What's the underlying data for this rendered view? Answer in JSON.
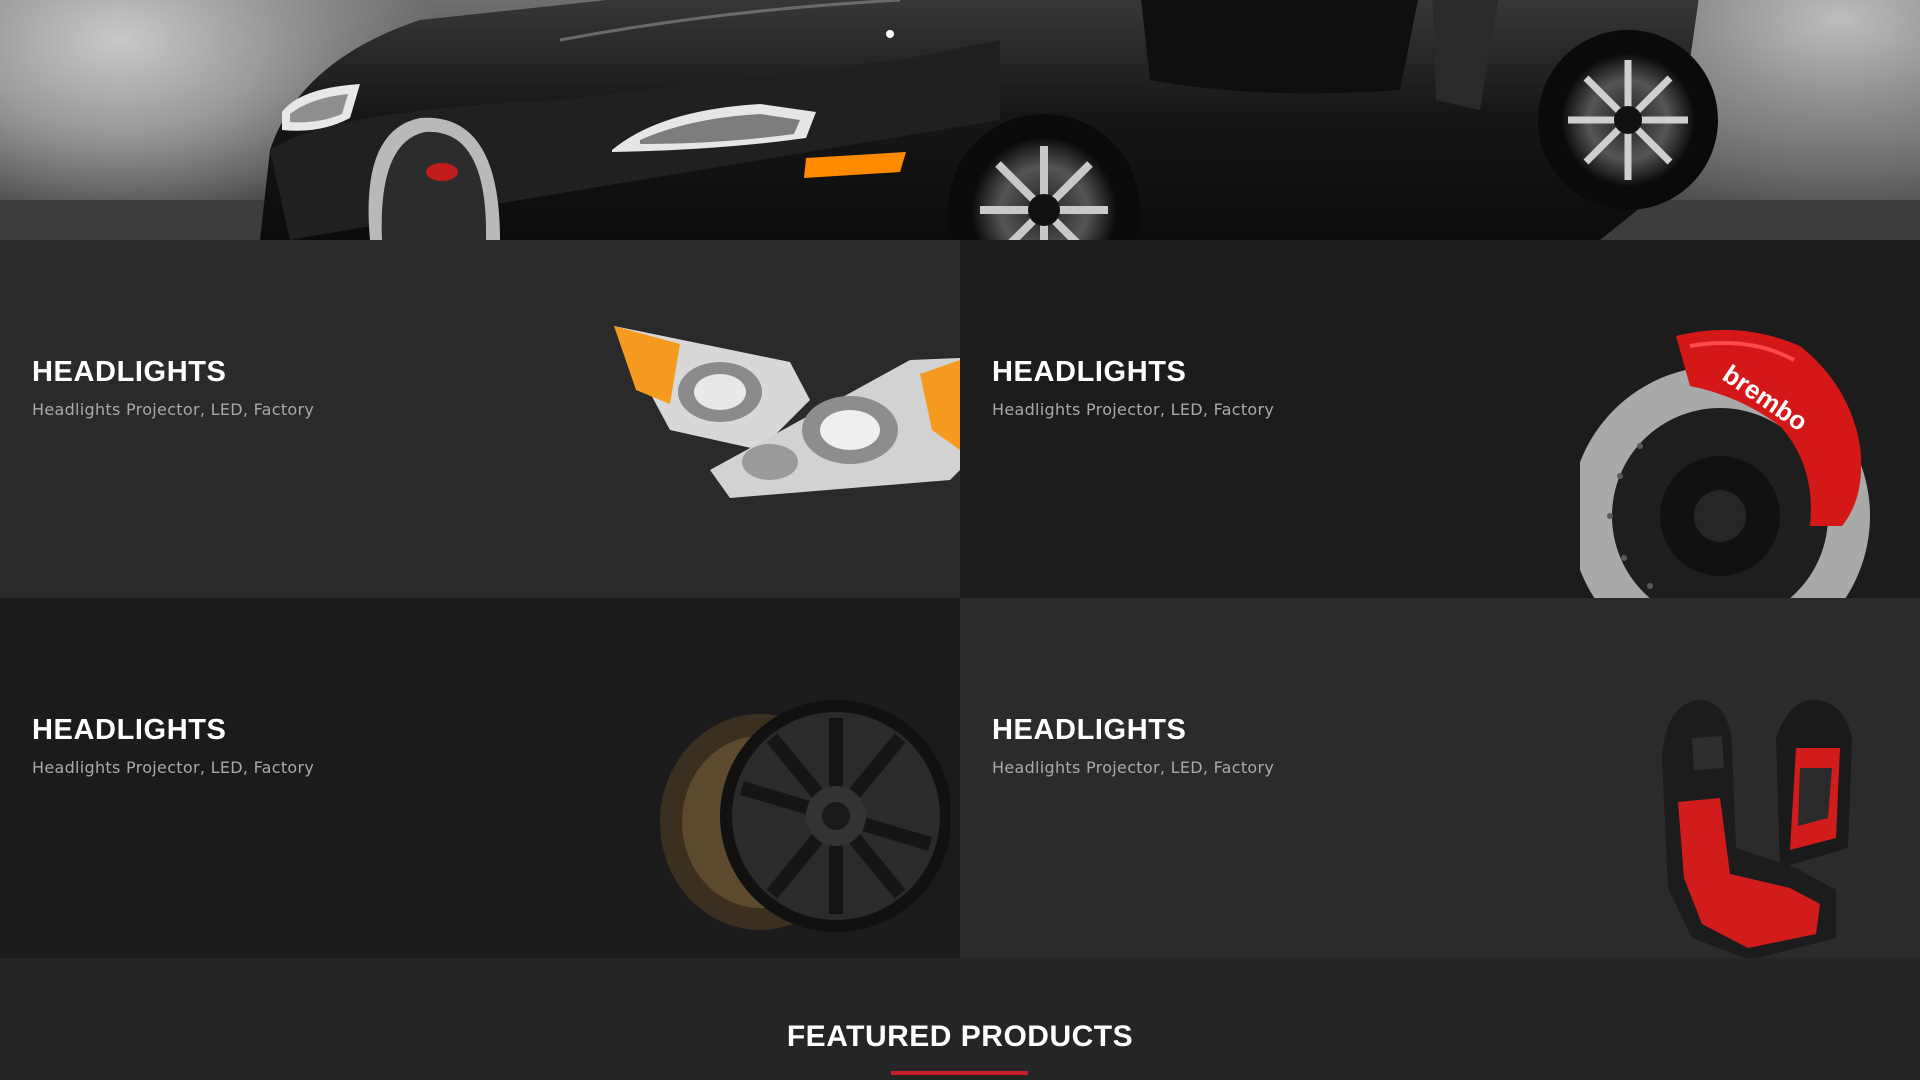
{
  "hero": {
    "alt": "black-sports-car"
  },
  "categories": [
    {
      "title": "HEADLIGHTS",
      "subtitle": "Headlights Projector, LED, Factory",
      "icon": "headlights-image"
    },
    {
      "title": "HEADLIGHTS",
      "subtitle": "Headlights Projector, LED, Factory",
      "icon": "brake-caliper-image"
    },
    {
      "title": "HEADLIGHTS",
      "subtitle": "Headlights Projector, LED, Factory",
      "icon": "wheel-rim-image"
    },
    {
      "title": "HEADLIGHTS",
      "subtitle": "Headlights Projector, LED, Factory",
      "icon": "racing-seats-image"
    }
  ],
  "featured": {
    "title": "FEATURED PRODUCTS"
  },
  "colors": {
    "accent": "#c8202b",
    "text_muted": "#a9a9a9"
  }
}
